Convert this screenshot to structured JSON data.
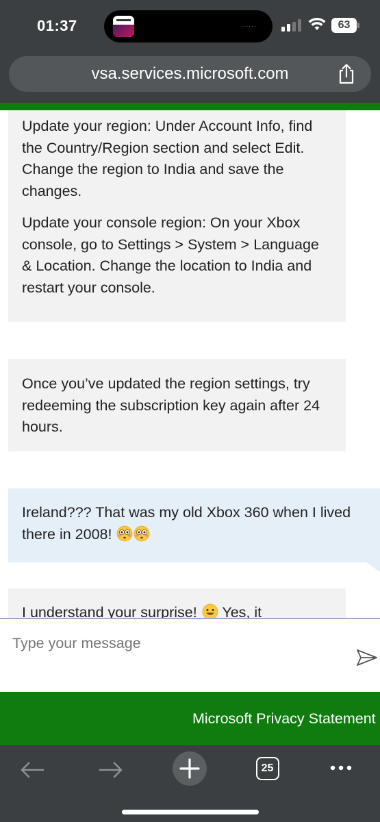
{
  "status_bar": {
    "time": "01:37",
    "battery": "63",
    "island_dots": "......"
  },
  "browser": {
    "url": "vsa.services.microsoft.com",
    "tab_count": "25"
  },
  "chat": {
    "messages": [
      {
        "role": "agent",
        "paragraphs": [
          "Update your region: Under Account Info, find the Country/Region section and select Edit. Change the region to India and save the changes.",
          "Update your console region: On your Xbox console, go to Settings > System > Language & Location. Change the location to India and restart your console."
        ]
      },
      {
        "role": "agent",
        "paragraphs": [
          "Once you’ve updated the region settings, try redeeming the subscription key again after 24 hours."
        ]
      },
      {
        "role": "user",
        "text": "Ireland??? That was my old Xbox 360 when I lived there in 2008!",
        "emojis": [
          "flushed-face-emoji",
          "flushed-face-emoji"
        ]
      },
      {
        "role": "agent",
        "text": "I understand your surprise!",
        "text_after": "Yes, it",
        "emojis": [
          "grinning-face-emoji"
        ]
      }
    ]
  },
  "input": {
    "placeholder": "Type your message"
  },
  "footer": {
    "privacy_link": "Microsoft Privacy Statement"
  },
  "colors": {
    "chrome": "#3c3f41",
    "brand_green": "#107c10",
    "agent_bubble": "#f2f2f2",
    "user_bubble": "#e5eff8"
  }
}
